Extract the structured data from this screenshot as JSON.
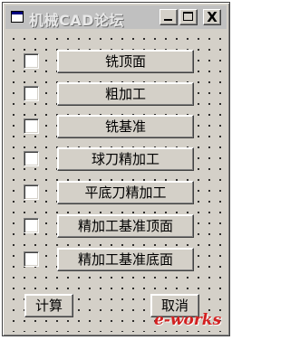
{
  "window": {
    "title": "机械CAD论坛",
    "buttons": {
      "minimize": "_",
      "maximize": "□",
      "close": "X"
    }
  },
  "options": [
    {
      "label": "铣顶面",
      "checked": false
    },
    {
      "label": "粗加工",
      "checked": false
    },
    {
      "label": "铣基准",
      "checked": false
    },
    {
      "label": "球刀精加工",
      "checked": false
    },
    {
      "label": "平底刀精加工",
      "checked": false
    },
    {
      "label": "精加工基准顶面",
      "checked": false
    },
    {
      "label": "精加工基准底面",
      "checked": false
    }
  ],
  "actions": {
    "calculate": "计算",
    "cancel": "取消"
  },
  "watermark": "e-works"
}
